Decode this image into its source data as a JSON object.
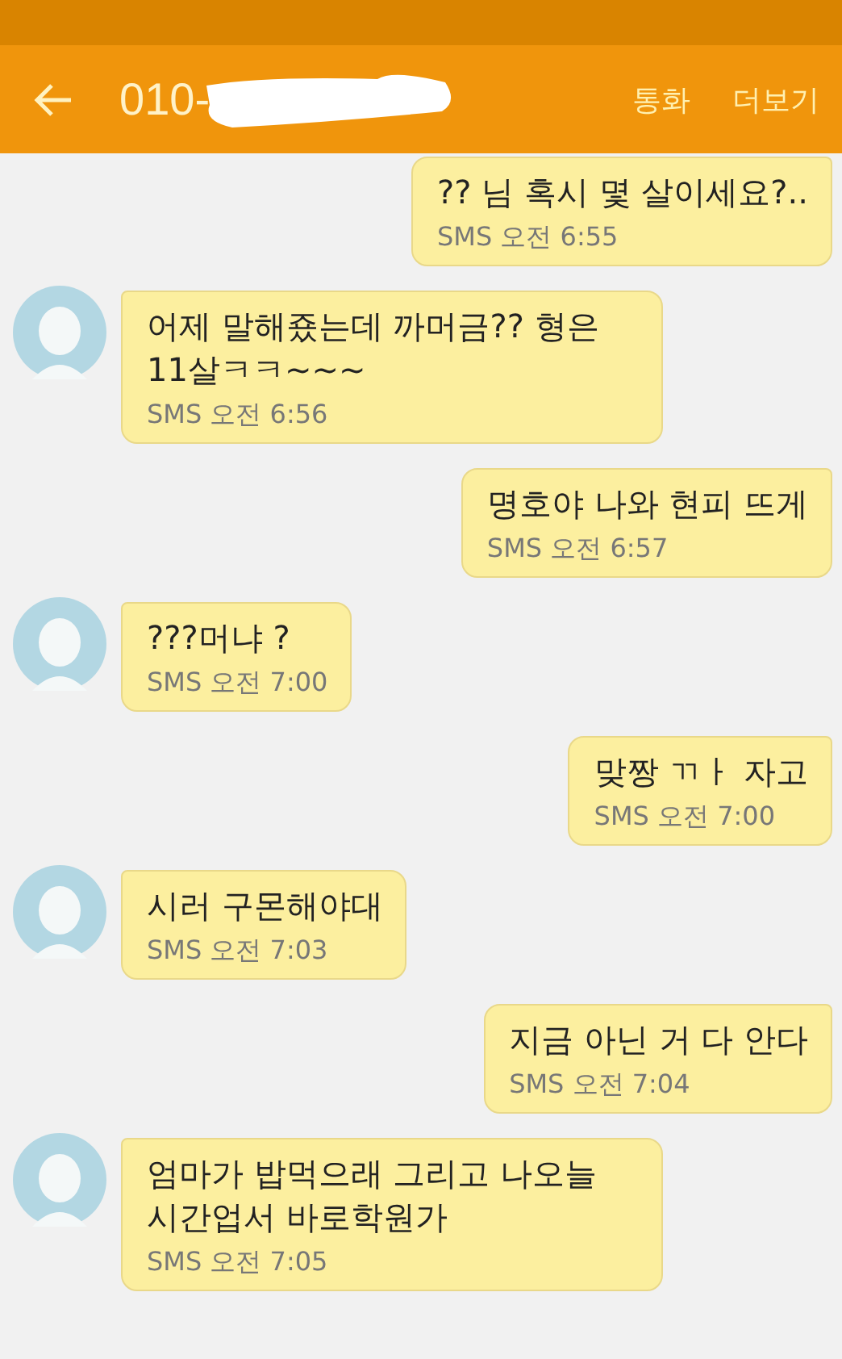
{
  "header": {
    "title": "010-",
    "actions": [
      "통화",
      "더보기"
    ]
  },
  "messages": [
    {
      "sent": true,
      "text": "?? 님 혹시 몇 살이세요?..",
      "time": "SMS 오전 6:55"
    },
    {
      "sent": false,
      "text": "어제 말해죴는데 까머금??  형은 11살ㅋㅋ~~~",
      "time": "SMS 오전 6:56"
    },
    {
      "sent": true,
      "text": "명호야 나와 현피 뜨게",
      "time": "SMS 오전 6:57"
    },
    {
      "sent": false,
      "text": "???머냐 ?",
      "time": "SMS 오전 7:00"
    },
    {
      "sent": true,
      "text": "맞짱 ㄲㅏ 자고",
      "time": "SMS 오전 7:00"
    },
    {
      "sent": false,
      "text": "시러 구몬해야대",
      "time": "SMS 오전 7:03"
    },
    {
      "sent": true,
      "text": "지금 아닌 거 다 안다",
      "time": "SMS 오전 7:04"
    },
    {
      "sent": false,
      "text": "엄마가 밥먹으래 그리고 나오늘 시간업서 바로학원가",
      "time": "SMS 오전 7:05"
    }
  ]
}
